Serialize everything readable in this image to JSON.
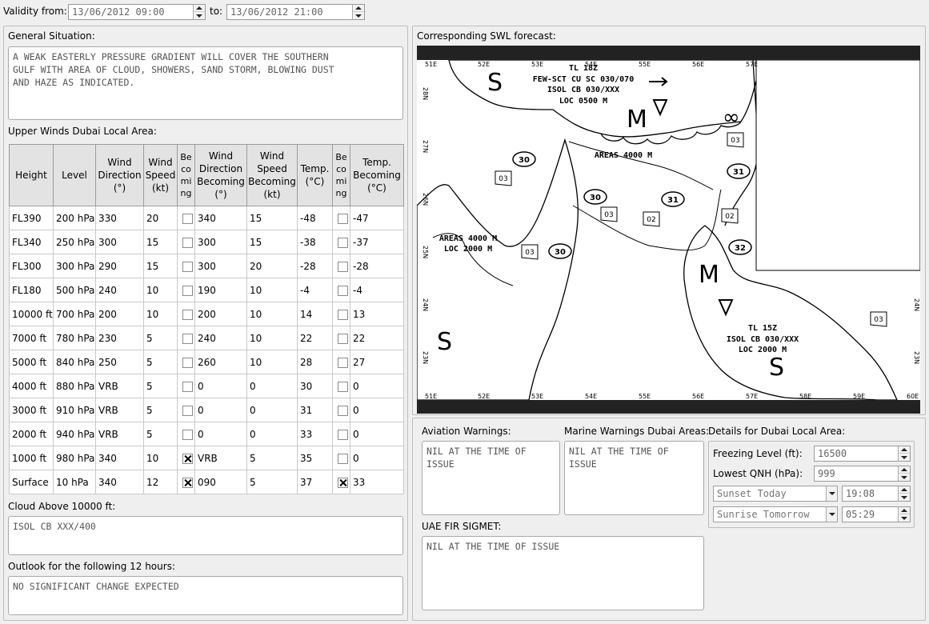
{
  "validity": {
    "from_label": "Validity from:",
    "from_value": "13/06/2012 09:00",
    "to_label": "to:",
    "to_value": "13/06/2012 21:00"
  },
  "general_situation": {
    "label": "General Situation:",
    "text": "A WEAK EASTERLY PRESSURE GRADIENT WILL COVER THE SOUTHERN\nGULF WITH AREA OF CLOUD, SHOWERS, SAND STORM, BLOWING DUST\nAND HAZE AS INDICATED."
  },
  "upper_winds": {
    "label": "Upper Winds Dubai Local Area:",
    "headers": [
      "Height",
      "Level",
      "Wind Direction (°)",
      "Wind Speed (kt)",
      "Be co mi ng",
      "Wind Direction Becoming (°)",
      "Wind Speed Becoming (kt)",
      "Temp. (°C)",
      "Be co mi ng",
      "Temp. Becoming (°C)"
    ],
    "rows": [
      {
        "height": "FL390",
        "level": "200 hPa",
        "dir": "330",
        "speed": "20",
        "becoming1": false,
        "dir_b": "340",
        "speed_b": "15",
        "temp": "-48",
        "becoming2": false,
        "temp_b": "-47"
      },
      {
        "height": "FL340",
        "level": "250 hPa",
        "dir": "300",
        "speed": "15",
        "becoming1": false,
        "dir_b": "300",
        "speed_b": "15",
        "temp": "-38",
        "becoming2": false,
        "temp_b": "-37"
      },
      {
        "height": "FL300",
        "level": "300 hPa",
        "dir": "290",
        "speed": "15",
        "becoming1": false,
        "dir_b": "300",
        "speed_b": "20",
        "temp": "-28",
        "becoming2": false,
        "temp_b": "-28"
      },
      {
        "height": "FL180",
        "level": "500 hPa",
        "dir": "240",
        "speed": "10",
        "becoming1": false,
        "dir_b": "190",
        "speed_b": "10",
        "temp": "-4",
        "becoming2": false,
        "temp_b": "-4"
      },
      {
        "height": "10000 ft",
        "level": "700 hPa",
        "dir": "200",
        "speed": "10",
        "becoming1": false,
        "dir_b": "200",
        "speed_b": "10",
        "temp": "14",
        "becoming2": false,
        "temp_b": "13"
      },
      {
        "height": "7000 ft",
        "level": "780 hPa",
        "dir": "230",
        "speed": "5",
        "becoming1": false,
        "dir_b": "240",
        "speed_b": "10",
        "temp": "22",
        "becoming2": false,
        "temp_b": "22"
      },
      {
        "height": "5000 ft",
        "level": "840 hPa",
        "dir": "250",
        "speed": "5",
        "becoming1": false,
        "dir_b": "260",
        "speed_b": "10",
        "temp": "28",
        "becoming2": false,
        "temp_b": "27"
      },
      {
        "height": "4000 ft",
        "level": "880 hPa",
        "dir": "VRB",
        "speed": "5",
        "becoming1": false,
        "dir_b": "0",
        "speed_b": "0",
        "temp": "30",
        "becoming2": false,
        "temp_b": "0"
      },
      {
        "height": "3000 ft",
        "level": "910 hPa",
        "dir": "VRB",
        "speed": "5",
        "becoming1": false,
        "dir_b": "0",
        "speed_b": "0",
        "temp": "31",
        "becoming2": false,
        "temp_b": "0"
      },
      {
        "height": "2000 ft",
        "level": "940 hPa",
        "dir": "VRB",
        "speed": "5",
        "becoming1": false,
        "dir_b": "0",
        "speed_b": "0",
        "temp": "33",
        "becoming2": false,
        "temp_b": "0"
      },
      {
        "height": "1000 ft",
        "level": "980 hPa",
        "dir": "340",
        "speed": "10",
        "becoming1": true,
        "dir_b": "VRB",
        "speed_b": "5",
        "temp": "35",
        "becoming2": false,
        "temp_b": "0"
      },
      {
        "height": "Surface",
        "level": "10 hPa",
        "dir": "340",
        "speed": "12",
        "becoming1": true,
        "dir_b": "090",
        "speed_b": "5",
        "temp": "37",
        "becoming2": true,
        "temp_b": "33"
      }
    ]
  },
  "cloud": {
    "label": "Cloud Above 10000 ft:",
    "text": "ISOL CB XXX/400"
  },
  "outlook": {
    "label": "Outlook for the following 12 hours:",
    "text": "NO SIGNIFICANT CHANGE EXPECTED"
  },
  "swl": {
    "label": "Corresponding SWL forecast:",
    "top_lon": [
      "51E",
      "52E",
      "53E",
      "54E",
      "55E",
      "56E",
      "57E"
    ],
    "bottom_lon": [
      "51E",
      "52E",
      "53E",
      "54E",
      "55E",
      "56E",
      "57E",
      "58E",
      "59E",
      "60E"
    ],
    "left_lat": [
      "28N",
      "27N",
      "26N",
      "25N",
      "24N",
      "23N"
    ],
    "right_lat": [
      "24N",
      "23N"
    ],
    "box_north": [
      "TL 18Z",
      "FEW-SCT CU SC 030/070",
      "ISOL CB 030/XXX",
      "LOC 0500 M"
    ],
    "box_areas_4000": "AREAS 4000 M",
    "box_west": [
      "AREAS 4000 M",
      "LOC 2000 M"
    ],
    "box_south": [
      "TL 15Z",
      "ISOL CB 030/XXX",
      "LOC 2000 M"
    ],
    "freezing_ovals": [
      "30",
      "30",
      "31",
      "31",
      "30",
      "32"
    ],
    "vis_flags": [
      "03",
      "03",
      "02",
      "02",
      "03",
      "03",
      "03"
    ]
  },
  "aviation": {
    "label": "Aviation Warnings:",
    "text": "NIL AT THE TIME OF\nISSUE"
  },
  "marine": {
    "label": "Marine Warnings Dubai Areas:",
    "text": "NIL AT THE TIME OF\nISSUE"
  },
  "sigmet": {
    "label": "UAE FIR SIGMET:",
    "text": "NIL AT THE TIME OF ISSUE"
  },
  "details": {
    "label": "Details for Dubai Local Area:",
    "freezing_label": "Freezing Level (ft):",
    "freezing_value": "16500",
    "qnh_label": "Lowest QNH (hPa):",
    "qnh_value": "999",
    "sunset_label": "Sunset Today",
    "sunset_value": "19:08",
    "sunrise_label": "Sunrise Tomorrow",
    "sunrise_value": "05:29"
  }
}
